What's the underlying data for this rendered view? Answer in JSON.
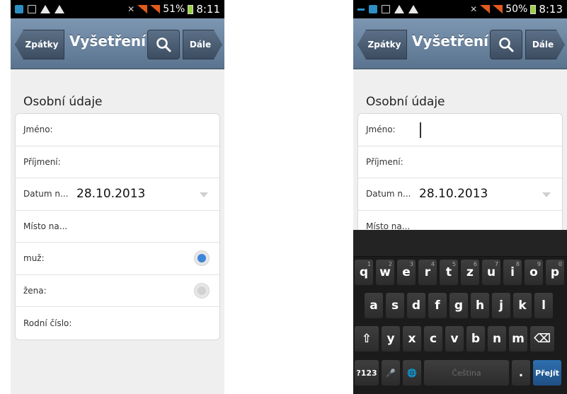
{
  "left": {
    "status": {
      "battery": "51%",
      "time": "8:11"
    },
    "nav": {
      "back": "Zpátky",
      "title": "Vyšetření",
      "next": "Dále"
    },
    "section_title": "Osobní údaje",
    "rows": [
      {
        "label": "Jméno:",
        "value": ""
      },
      {
        "label": "Příjmení:",
        "value": ""
      },
      {
        "label": "Datum n...",
        "value": "28.10.2013"
      },
      {
        "label": "Místo na...",
        "value": ""
      },
      {
        "label": "muž:",
        "value": "",
        "radio": "on"
      },
      {
        "label": "žena:",
        "value": "",
        "radio": "off"
      },
      {
        "label": "Rodní číslo:",
        "value": ""
      }
    ]
  },
  "right": {
    "status": {
      "battery": "50%",
      "time": "8:13"
    },
    "nav": {
      "back": "Zpátky",
      "title": "Vyšetření",
      "next": "Dále"
    },
    "section_title": "Osobní údaje",
    "rows": [
      {
        "label": "Jméno:",
        "value": ""
      },
      {
        "label": "Příjmení:",
        "value": ""
      },
      {
        "label": "Datum n...",
        "value": "28.10.2013"
      },
      {
        "label": "Místo na...",
        "value": ""
      }
    ],
    "keyboard": {
      "row1": [
        {
          "k": "q",
          "n": "1"
        },
        {
          "k": "w",
          "n": "2"
        },
        {
          "k": "e",
          "n": "3"
        },
        {
          "k": "r",
          "n": "4"
        },
        {
          "k": "t",
          "n": "5"
        },
        {
          "k": "z",
          "n": "6"
        },
        {
          "k": "u",
          "n": "7"
        },
        {
          "k": "i",
          "n": "8"
        },
        {
          "k": "o",
          "n": "9"
        },
        {
          "k": "p",
          "n": "0"
        }
      ],
      "row2": [
        "a",
        "s",
        "d",
        "f",
        "g",
        "h",
        "j",
        "k",
        "l"
      ],
      "row3": [
        "y",
        "x",
        "c",
        "v",
        "b",
        "n",
        "m"
      ],
      "shift": "⇧",
      "backspace": "⌫",
      "symbols": "?123",
      "mic": "🎤",
      "globe": "🌐",
      "space": "Čeština",
      "period": ".",
      "go": "Přejít"
    }
  },
  "colors": {
    "accent": "#3b86d8",
    "nav_top": "#7d97b2",
    "nav_bottom": "#5a738f",
    "go_key": "#2e6fae"
  }
}
